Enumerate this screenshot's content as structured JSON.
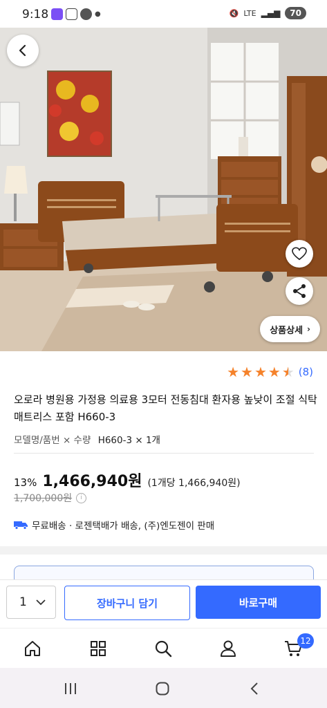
{
  "status_bar": {
    "time": "9:18",
    "battery": "70",
    "network": "LTE"
  },
  "product": {
    "rating_value": 4.5,
    "rating_count": "(8)",
    "title": "오로라 병원용 가정용 의료용 3모터 전동침대 환자용 높낮이 조절 식탁 매트리스 포함 H660-3",
    "model_label": "모델명/품번 × 수량",
    "model_value": "H660-3 × 1개",
    "discount_rate": "13%",
    "price": "1,466,940원",
    "unit_price": "(1개당 1,466,940원)",
    "original_price": "1,700,000원",
    "shipping_text": "무료배송 · 로젠택배가 배송, (주)엔도젠이 판매"
  },
  "hero": {
    "detail_button": "상품상세",
    "icons": [
      "back-arrow-icon",
      "heart-icon",
      "share-icon"
    ]
  },
  "purchase": {
    "quantity": "1",
    "cart_button": "장바구니 담기",
    "buy_button": "바로구매"
  },
  "tabbar": {
    "items": [
      "home-icon",
      "category-icon",
      "search-icon",
      "user-icon",
      "cart-icon"
    ],
    "cart_count": "12"
  },
  "colors": {
    "accent": "#346aff",
    "star": "#f5822b"
  }
}
